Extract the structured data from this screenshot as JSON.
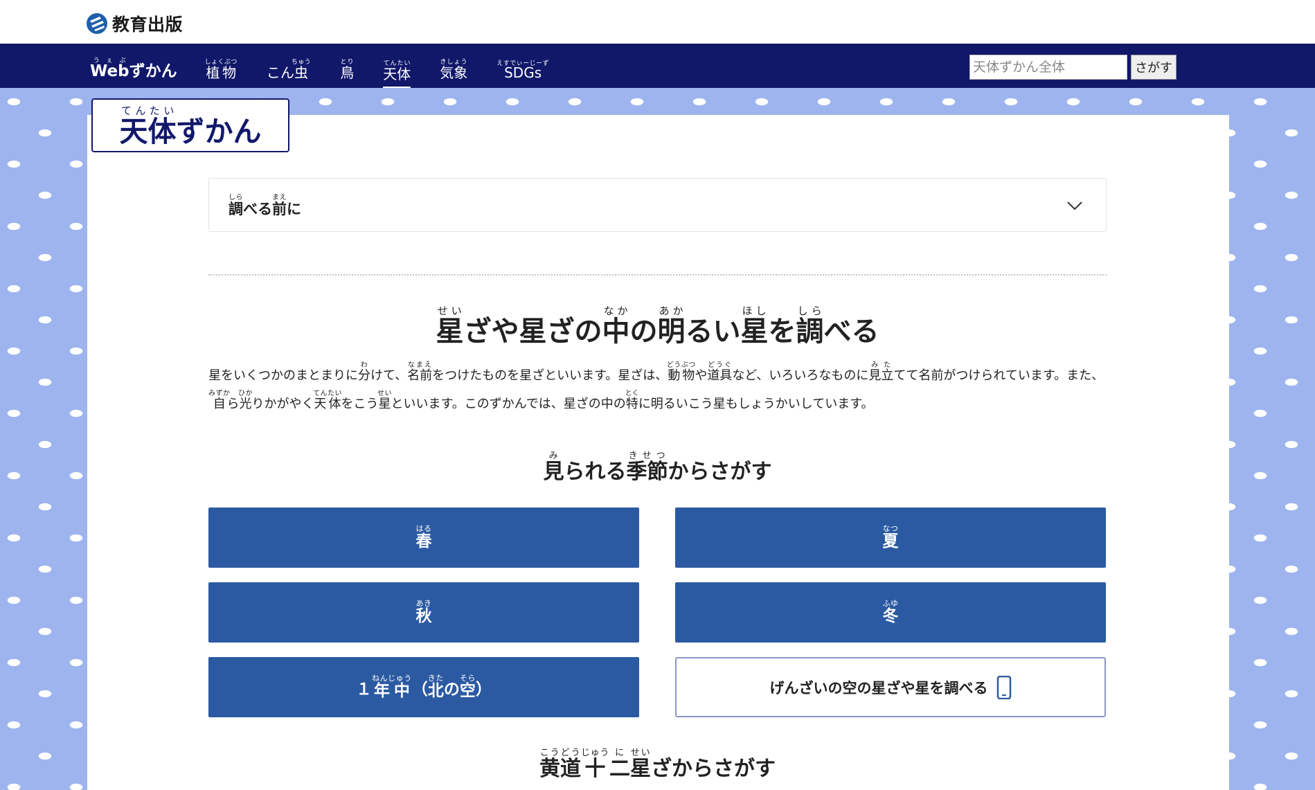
{
  "brand": {
    "name": "教育出版"
  },
  "nav": {
    "items": [
      {
        "label": "Webずかん",
        "base": "Web",
        "kana_tail": "ずかん",
        "ruby": "うぇぶ"
      },
      {
        "label": "植物",
        "ruby": "しょくぶつ"
      },
      {
        "label": "こん虫",
        "pre": "こん",
        "kanji": "虫",
        "ruby": "ちゅう"
      },
      {
        "label": "鳥",
        "ruby": "とり"
      },
      {
        "label": "天体",
        "ruby": "てんたい",
        "active": true
      },
      {
        "label": "気象",
        "ruby": "きしょう"
      },
      {
        "label": "SDGs",
        "ruby": "えすでぃーじーず"
      }
    ]
  },
  "search": {
    "placeholder": "天体ずかん全体",
    "button_label": "さがす"
  },
  "page_title": {
    "kanji": "天体",
    "ruby": "てんたい",
    "rest": "ずかん"
  },
  "accordion": {
    "label": "調べる前に",
    "parts": {
      "k1": "調",
      "r1": "しら",
      "k2": "べる",
      "k3": "前",
      "r3": "まえ",
      "k4": "に"
    },
    "icon": "chevron-down-icon"
  },
  "main_heading": {
    "text": "星ざや星ざの中の明るい星を調べる",
    "parts": {
      "k1": "星",
      "r1": "せい",
      "t1": "ざや星ざの",
      "k2": "中",
      "r2": "なか",
      "t2": "の",
      "k3": "明",
      "r3": "あか",
      "t3": "るい",
      "k4": "星",
      "r4": "ほし",
      "t4": "を",
      "k5": "調",
      "r5": "しら",
      "t5": "べる"
    }
  },
  "intro": {
    "text": "星をいくつかのまとまりに分けて、名前をつけたものを星ざといいます。星ざは、動物や道具など、いろいろなものに見立てて名前がつけられています。また、自ら光りかがやく天体をこう星といいます。このずかんでは、星ざの中の特に明るいこう星もしょうかいしています。",
    "parts": {
      "a": "星をいくつかのまとまりに",
      "b_k": "分",
      "b_r": "わ",
      "c": "けて、",
      "d_k": "名前",
      "d_r": "なまえ",
      "e": "をつけたものを星ざといいます。星ざは、",
      "f_k": "動物",
      "f_r": "どうぶつ",
      "g": "や",
      "h_k": "道具",
      "h_r": "どうぐ",
      "i": "など、いろいろなものに",
      "j_k": "見立",
      "j_r": "みた",
      "k": "てて名前がつけられています。また、",
      "l_k": "自",
      "l_r": "みずか",
      "m": "ら",
      "n_k": "光",
      "n_r": "ひか",
      "o": "りかがやく",
      "p_k": "天体",
      "p_r": "てんたい",
      "q": "をこう",
      "s_k": "星",
      "s_r": "せい",
      "t": "といいます。このずかんでは、星ざの中の",
      "u_k": "特",
      "u_r": "とく",
      "v": "に明るいこう星もしょうかいしています。"
    }
  },
  "season_section": {
    "heading": "見られる季節からさがす",
    "parts": {
      "k1": "見",
      "r1": "み",
      "t1": "られる",
      "k2": "季節",
      "r2": "きせつ",
      "t2": "からさがす"
    },
    "buttons": [
      {
        "label": "春",
        "ruby": "はる"
      },
      {
        "label": "夏",
        "ruby": "なつ"
      },
      {
        "label": "秋",
        "ruby": "あき"
      },
      {
        "label": "冬",
        "ruby": "ふゆ"
      },
      {
        "label": "１年中（北の空）",
        "parts": {
          "a": "１",
          "b_k": "年中",
          "b_r": "ねんじゅう",
          "c": "（",
          "d_k": "北",
          "d_r": "きた",
          "e": "の",
          "f_k": "空",
          "f_r": "そら",
          "g": "）"
        }
      }
    ],
    "now_button": {
      "label": "げんざいの空の星ざや星を調べる",
      "icon": "smartphone-icon"
    }
  },
  "zodiac_section": {
    "heading": "黄道十二星ざからさがす",
    "parts": {
      "k1": "黄道",
      "r1": "こうどう",
      "k2": "十",
      "r2": "じゅう",
      "k3": "二",
      "r3": "に",
      "k4": "星",
      "r4": "せい",
      "t4": "ざからさがす"
    }
  },
  "colors": {
    "nav_bg": "#11186a",
    "button_bg": "#2b5aa2",
    "pattern_bg": "#9db4ee",
    "title_border": "#11186a"
  }
}
